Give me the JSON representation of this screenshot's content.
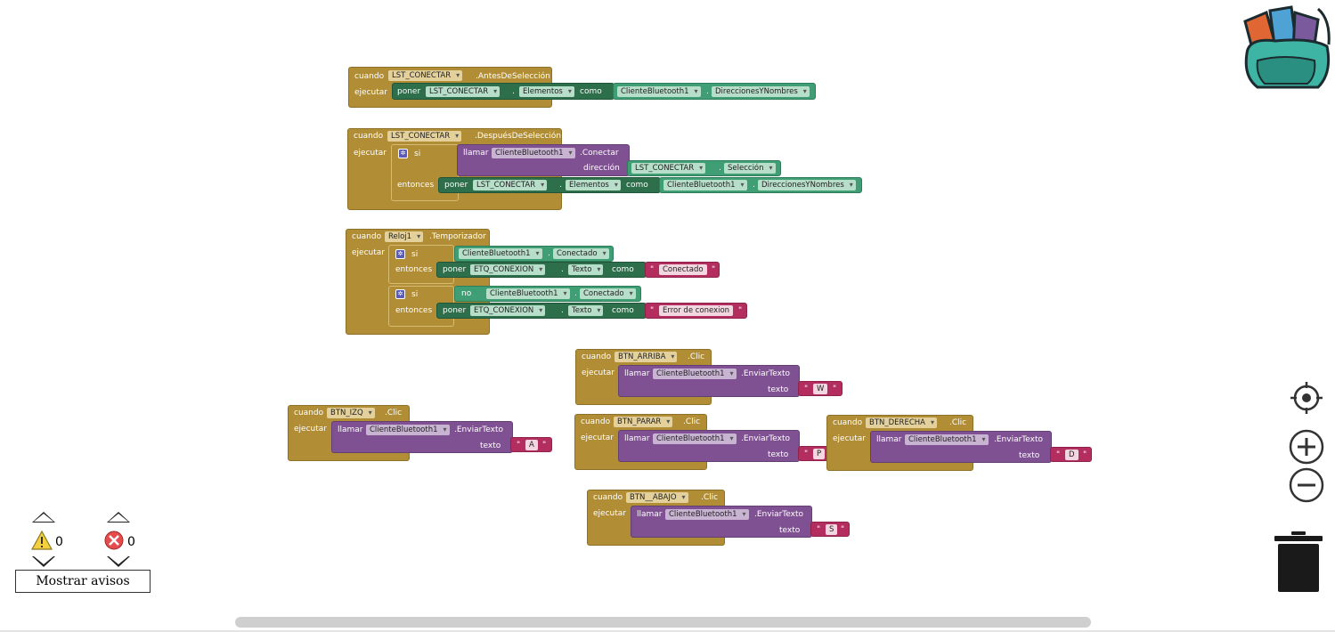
{
  "blocks": {
    "b1": {
      "when": "cuando",
      "comp": "LST_CONECTAR",
      "event": ".AntesDeSelección",
      "do": "ejecutar",
      "set": "poner",
      "target": "LST_CONECTAR",
      "prop": "Elementos",
      "as": "como",
      "src": "ClienteBluetooth1",
      "srcprop": "DireccionesYNombres"
    },
    "b2": {
      "when": "cuando",
      "comp": "LST_CONECTAR",
      "event": ".DespuésDeSelección",
      "do": "ejecutar",
      "if": "si",
      "call": "llamar",
      "callcomp": "ClienteBluetooth1",
      "method": ".Conectar",
      "arg": "dirección",
      "argcomp": "LST_CONECTAR",
      "argprop": "Selección",
      "then": "entonces",
      "set": "poner",
      "target": "LST_CONECTAR",
      "prop": "Elementos",
      "as": "como",
      "src": "ClienteBluetooth1",
      "srcprop": "DireccionesYNombres"
    },
    "b3": {
      "when": "cuando",
      "comp": "Reloj1",
      "event": ".Temporizador",
      "do": "ejecutar",
      "if1": "si",
      "cond1comp": "ClienteBluetooth1",
      "cond1prop": "Conectado",
      "then1": "entonces",
      "set1": "poner",
      "target1": "ETQ_CONEXION",
      "prop1": "Texto",
      "as1": "como",
      "val1": "Conectado",
      "if2": "si",
      "not": "no",
      "cond2comp": "ClienteBluetooth1",
      "cond2prop": "Conectado",
      "then2": "entonces",
      "set2": "poner",
      "target2": "ETQ_CONEXION",
      "prop2": "Texto",
      "as2": "como",
      "val2": "Error de conexion"
    },
    "up": {
      "when": "cuando",
      "comp": "BTN_ARRIBA",
      "event": ".Clic",
      "do": "ejecutar",
      "call": "llamar",
      "callcomp": "ClienteBluetooth1",
      "method": ".EnviarTexto",
      "arg": "texto",
      "val": "W"
    },
    "left": {
      "when": "cuando",
      "comp": "BTN_IZQ",
      "event": ".Clic",
      "do": "ejecutar",
      "call": "llamar",
      "callcomp": "ClienteBluetooth1",
      "method": ".EnviarTexto",
      "arg": "texto",
      "val": "A"
    },
    "stop": {
      "when": "cuando",
      "comp": "BTN_PARAR",
      "event": ".Clic",
      "do": "ejecutar",
      "call": "llamar",
      "callcomp": "ClienteBluetooth1",
      "method": ".EnviarTexto",
      "arg": "texto",
      "val": "P"
    },
    "right": {
      "when": "cuando",
      "comp": "BTN_DERECHA",
      "event": ".Clic",
      "do": "ejecutar",
      "call": "llamar",
      "callcomp": "ClienteBluetooth1",
      "method": ".EnviarTexto",
      "arg": "texto",
      "val": "D"
    },
    "down": {
      "when": "cuando",
      "comp": "BTN__ABAJO",
      "event": ".Clic",
      "do": "ejecutar",
      "call": "llamar",
      "callcomp": "ClienteBluetooth1",
      "method": ".EnviarTexto",
      "arg": "texto",
      "val": "S"
    }
  },
  "quote": "\"",
  "warnings": {
    "count": "0",
    "errors": "0",
    "button": "Mostrar avisos",
    "warn_icon": "warning-triangle-icon",
    "error_icon": "error-circle-icon"
  },
  "controls": {
    "center_icon": "crosshair-icon",
    "zoom_in_icon": "zoom-in-icon",
    "zoom_out_icon": "zoom-out-icon",
    "trash_icon": "trash-icon",
    "backpack_icon": "backpack-icon"
  },
  "colors": {
    "event": "#b18e35",
    "procedure": "#7f5192",
    "setter": "#2d6e4b",
    "getter": "#3f9e74",
    "text": "#b32d5e"
  }
}
